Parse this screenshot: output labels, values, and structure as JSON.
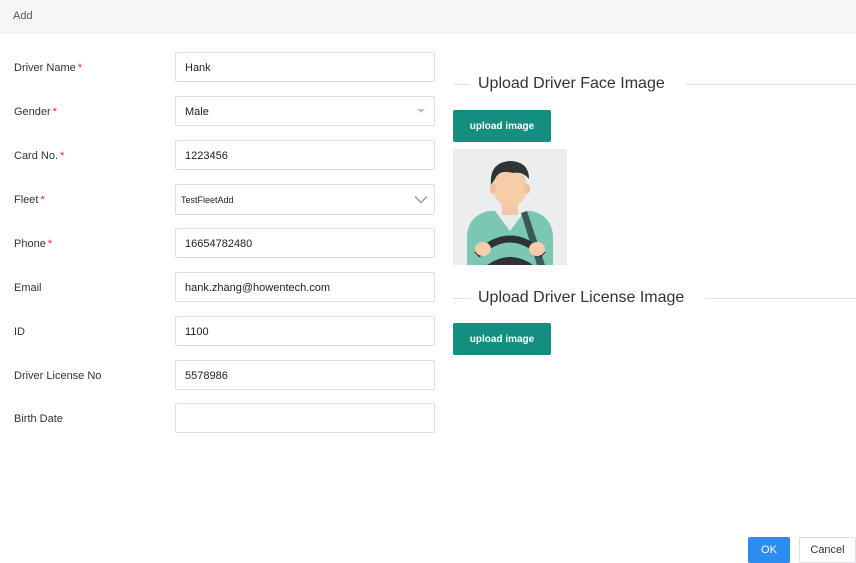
{
  "dialog": {
    "title": "Add"
  },
  "form": {
    "required_mark": "*",
    "fields": [
      {
        "label": "Driver Name",
        "value": "Hank",
        "required": true
      },
      {
        "label": "Gender",
        "value": "Male",
        "required": true
      },
      {
        "label": "Card No.",
        "value": "1223456",
        "required": true
      },
      {
        "label": "Fleet",
        "value": "TestFleetAdd",
        "required": true
      },
      {
        "label": "Phone",
        "value": "16654782480",
        "required": true
      },
      {
        "label": "Email",
        "value": "hank.zhang@howentech.com",
        "required": false
      },
      {
        "label": "ID",
        "value": "1100",
        "required": false
      },
      {
        "label": "Driver License No",
        "value": "5578986",
        "required": false
      },
      {
        "label": "Birth Date",
        "value": "",
        "required": false
      }
    ]
  },
  "face_section": {
    "title": "Upload Driver Face Image",
    "upload_label": "upload image",
    "image_icon": "driver-avatar-icon"
  },
  "license_section": {
    "title": "Upload Driver License Image",
    "upload_label": "upload image"
  },
  "footer": {
    "ok_label": "OK",
    "cancel_label": "Cancel"
  },
  "colors": {
    "accent": "#138e7f",
    "primary": "#2d8cf0",
    "required": "#f5222d"
  }
}
